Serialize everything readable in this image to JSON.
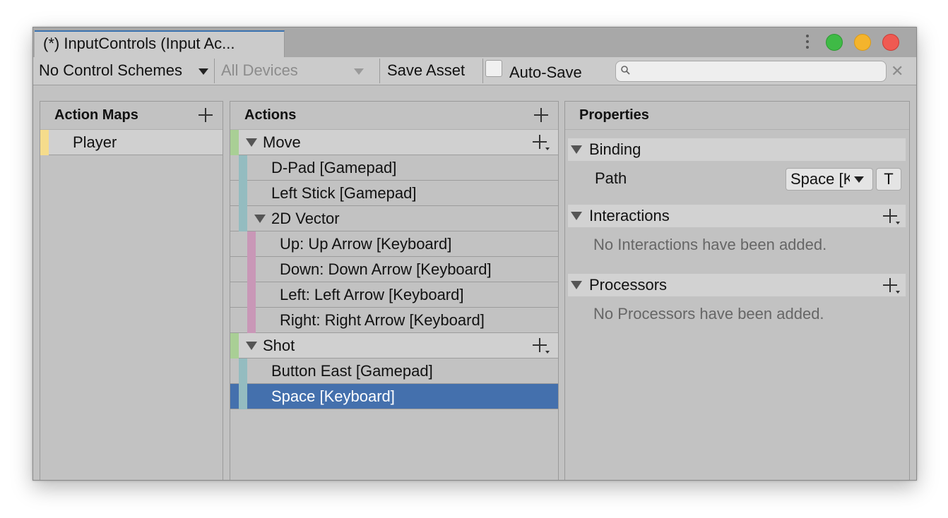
{
  "window": {
    "tab_title": "(*) InputControls (Input Ac...",
    "controls": [
      "green",
      "yellow",
      "red"
    ]
  },
  "toolbar": {
    "control_scheme": "No Control Schemes",
    "devices": "All Devices",
    "save_asset": "Save Asset",
    "auto_save_label": "Auto-Save",
    "auto_save_checked": false,
    "search_value": "",
    "search_placeholder": ""
  },
  "action_maps": {
    "header": "Action Maps",
    "items": [
      {
        "label": "Player",
        "color": "#f5dc8c"
      }
    ]
  },
  "actions": {
    "header": "Actions",
    "rows": [
      {
        "type": "action",
        "label": "Move"
      },
      {
        "type": "binding",
        "label": "D-Pad [Gamepad]"
      },
      {
        "type": "binding",
        "label": "Left Stick [Gamepad]"
      },
      {
        "type": "composite",
        "label": "2D Vector"
      },
      {
        "type": "part",
        "label": "Up: Up Arrow [Keyboard]"
      },
      {
        "type": "part",
        "label": "Down: Down Arrow [Keyboard]"
      },
      {
        "type": "part",
        "label": "Left: Left Arrow [Keyboard]"
      },
      {
        "type": "part",
        "label": "Right: Right Arrow [Keyboard]"
      },
      {
        "type": "action",
        "label": "Shot"
      },
      {
        "type": "binding",
        "label": "Button East [Gamepad]"
      },
      {
        "type": "binding",
        "label": "Space [Keyboard]",
        "selected": true
      }
    ],
    "colors": {
      "action": "#a9cf95",
      "binding": "#94bcc0",
      "part": "#c997b7"
    }
  },
  "properties": {
    "header": "Properties",
    "binding": {
      "title": "Binding",
      "path_label": "Path",
      "path_value": "Space [Keyboard]",
      "t_button": "T"
    },
    "interactions": {
      "title": "Interactions",
      "empty": "No Interactions have been added."
    },
    "processors": {
      "title": "Processors",
      "empty": "No Processors have been added."
    }
  },
  "colors": {
    "selection": "#4470ad",
    "tab_accent": "#3a72b0"
  }
}
